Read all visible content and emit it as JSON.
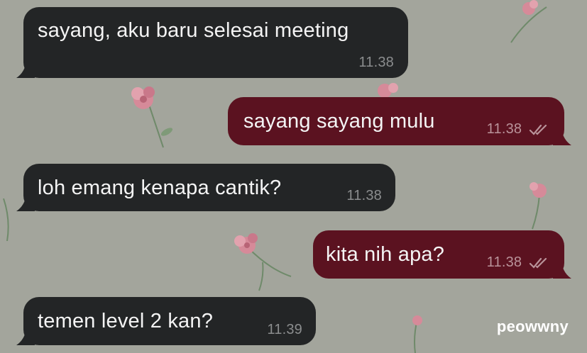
{
  "chat": {
    "messages": [
      {
        "direction": "incoming",
        "text": "sayang, aku baru selesai meeting",
        "time": "11.38"
      },
      {
        "direction": "outgoing",
        "text": "sayang sayang mulu",
        "time": "11.38",
        "status_icon": "double-check-icon"
      },
      {
        "direction": "incoming",
        "text": "loh emang kenapa cantik?",
        "time": "11.38"
      },
      {
        "direction": "outgoing",
        "text": "kita nih apa?",
        "time": "11.38",
        "status_icon": "double-check-icon"
      },
      {
        "direction": "incoming",
        "text": "temen level 2 kan?",
        "time": "11.39"
      }
    ]
  },
  "watermark": "peowwny",
  "colors": {
    "wallpaper": "#a3a59c",
    "incoming_bubble": "#232526",
    "outgoing_bubble": "#5b1220",
    "bubble_text": "#f4f4f4",
    "flower": "#d68a99"
  }
}
